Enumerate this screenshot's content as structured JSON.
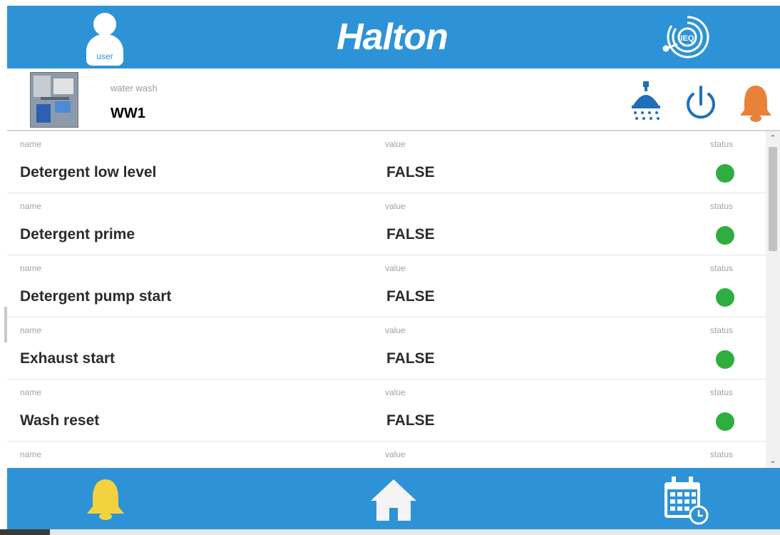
{
  "header": {
    "user_label": "user",
    "logo": "Halton",
    "ieq_label": "IEQ"
  },
  "device": {
    "subtitle": "water wash",
    "name": "WW1"
  },
  "list": {
    "rows": [
      {
        "name_label": "name",
        "name": "Detergent low level",
        "value_label": "value",
        "value": "FALSE",
        "status_label": "status",
        "status": "ok"
      },
      {
        "name_label": "name",
        "name": "Detergent prime",
        "value_label": "value",
        "value": "FALSE",
        "status_label": "status",
        "status": "ok"
      },
      {
        "name_label": "name",
        "name": "Detergent pump start",
        "value_label": "value",
        "value": "FALSE",
        "status_label": "status",
        "status": "ok"
      },
      {
        "name_label": "name",
        "name": "Exhaust start",
        "value_label": "value",
        "value": "FALSE",
        "status_label": "status",
        "status": "ok"
      },
      {
        "name_label": "name",
        "name": "Wash reset",
        "value_label": "value",
        "value": "FALSE",
        "status_label": "status",
        "status": "ok"
      },
      {
        "name_label": "name",
        "name": "",
        "value_label": "value",
        "value": "",
        "status_label": "status",
        "status": ""
      }
    ]
  },
  "colors": {
    "brand_blue": "#2e93d6",
    "status_ok": "#2eae3e",
    "alarm_orange": "#e8823a",
    "bell_yellow": "#f2d23f",
    "power_blue": "#1f6fb8"
  },
  "icons": {
    "user": "user-icon",
    "ieq": "ieq-icon",
    "shower": "shower-icon",
    "power": "power-icon",
    "alarm": "bell-icon",
    "nav_alarms": "bell-icon",
    "nav_home": "home-icon",
    "nav_schedule": "calendar-clock-icon"
  }
}
